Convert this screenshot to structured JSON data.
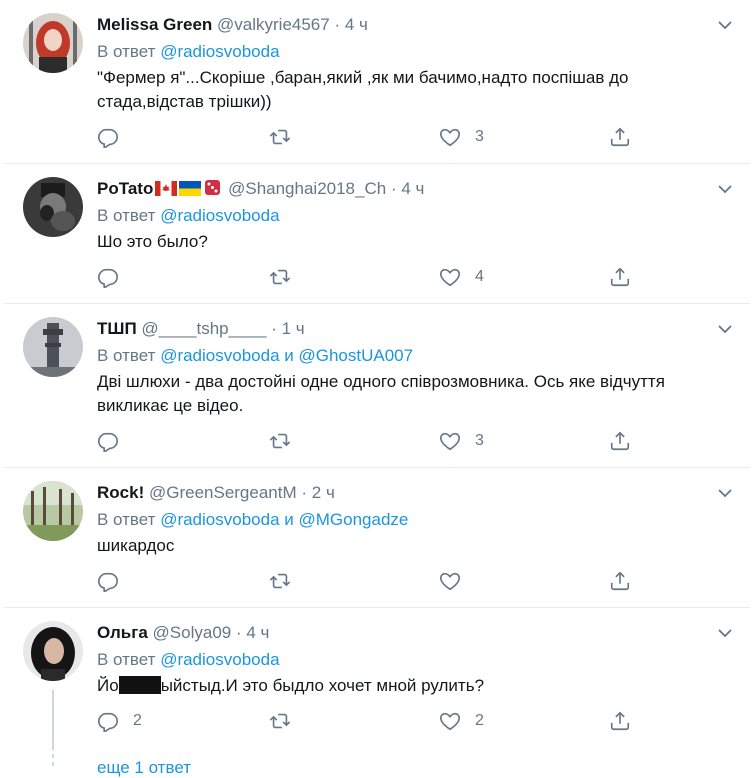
{
  "tweets": [
    {
      "name": "Melissa Green",
      "handle": "@valkyrie4567",
      "time": "4 ч",
      "reply_prefix": "В ответ",
      "reply_to": "@radiosvoboda",
      "text": "\"Фермер я\"...Скоріше ,баран,який ,як ми бачимо,надто поспішав до стада,відстав трішки))",
      "reply_count": "",
      "retweet_count": "",
      "like_count": "3"
    },
    {
      "name": "PoTato",
      "handle": "@Shanghai2018_Ch",
      "time": "4 ч",
      "reply_prefix": "В ответ",
      "reply_to": "@radiosvoboda",
      "text": "Шо это было?",
      "reply_count": "",
      "retweet_count": "",
      "like_count": "4"
    },
    {
      "name": "ТШП",
      "handle": "@____tshp____",
      "time": "1 ч",
      "reply_prefix": "В ответ",
      "reply_to": "@radiosvoboda",
      "reply_and": "и",
      "reply_to_2": "@GhostUA007",
      "text": "Дві шлюхи - два достойні одне одного співрозмовника. Ось яке відчуття викликає це відео.",
      "reply_count": "",
      "retweet_count": "",
      "like_count": "3"
    },
    {
      "name": "Rock!",
      "handle": "@GreenSergeantM",
      "time": "2 ч",
      "reply_prefix": "В ответ",
      "reply_to": "@radiosvoboda",
      "reply_and": "и",
      "reply_to_2": "@MGongadze",
      "text": "шикардос",
      "reply_count": "",
      "retweet_count": "",
      "like_count": ""
    },
    {
      "name": "Ольга",
      "handle": "@Solya09",
      "time": "4 ч",
      "reply_prefix": "В ответ",
      "reply_to": "@radiosvoboda",
      "text_before": "Йо",
      "text_after": "ыйстыд.И это быдло хочет мной рулить?",
      "reply_count": "2",
      "retweet_count": "",
      "like_count": "2"
    }
  ],
  "more_replies": "еще 1 ответ",
  "separator": "·",
  "colors": {
    "text": "#14171a",
    "secondary": "#657786",
    "link": "#1b95e0",
    "border": "#e6ecf0"
  },
  "icons": [
    "reply-icon",
    "retweet-icon",
    "like-icon",
    "share-icon",
    "chevron-down-icon"
  ]
}
